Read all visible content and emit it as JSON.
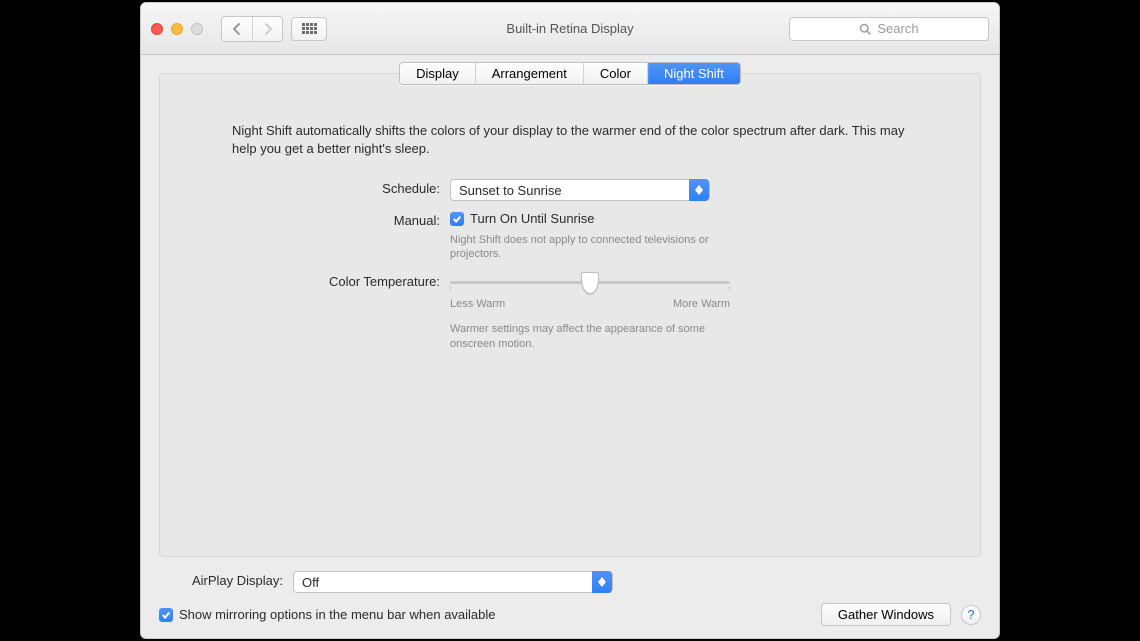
{
  "window_title": "Built-in Retina Display",
  "search_placeholder": "Search",
  "tabs": {
    "display": "Display",
    "arrangement": "Arrangement",
    "color": "Color",
    "night_shift": "Night Shift"
  },
  "intro": "Night Shift automatically shifts the colors of your display to the warmer end of the color spectrum after dark. This may help you get a better night's sleep.",
  "schedule": {
    "label": "Schedule:",
    "value": "Sunset to Sunrise"
  },
  "manual": {
    "label": "Manual:",
    "checkbox_label": "Turn On Until Sunrise",
    "hint": "Night Shift does not apply to connected televisions or projectors."
  },
  "color_temp": {
    "label": "Color Temperature:",
    "min_label": "Less Warm",
    "max_label": "More Warm",
    "hint": "Warmer settings may affect the appearance of some onscreen motion."
  },
  "airplay": {
    "label": "AirPlay Display:",
    "value": "Off"
  },
  "mirroring": {
    "label": "Show mirroring options in the menu bar when available"
  },
  "gather_windows": "Gather Windows"
}
